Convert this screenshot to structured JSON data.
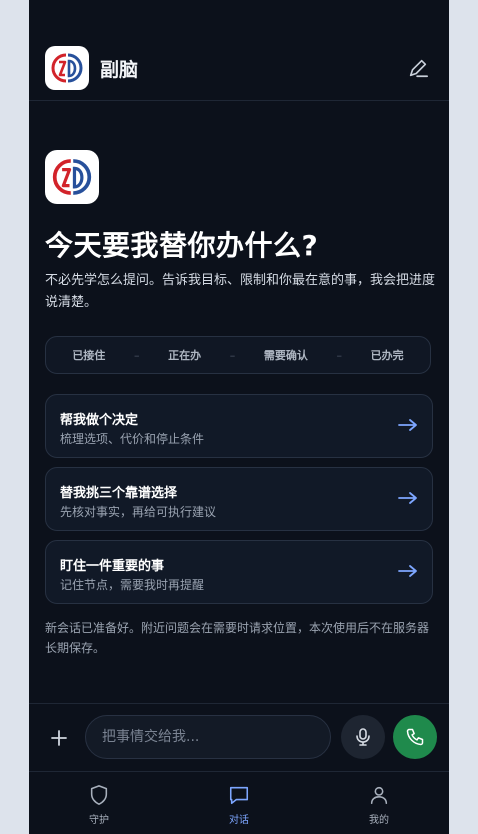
{
  "header": {
    "app_name": "副脑",
    "logo_icon": "brain-logo-icon",
    "edit_icon": "edit-icon"
  },
  "hero": {
    "headline": "今天要我替你办什么?",
    "subline": "不必先学怎么提问。告诉我目标、限制和你最在意的事，我会把进度说清楚。"
  },
  "steps": [
    "已接住",
    "正在办",
    "需要确认",
    "已办完"
  ],
  "step_separator": "–",
  "cards": [
    {
      "title": "帮我做个决定",
      "desc": "梳理选项、代价和停止条件"
    },
    {
      "title": "替我挑三个靠谱选择",
      "desc": "先核对事实，再给可执行建议"
    },
    {
      "title": "盯住一件重要的事",
      "desc": "记住节点，需要我时再提醒"
    }
  ],
  "notice": "新会话已准备好。附近问题会在需要时请求位置，本次使用后不在服务器长期保存。",
  "composer": {
    "placeholder": "把事情交给我...",
    "value": ""
  },
  "tabs": [
    {
      "label": "守护",
      "icon": "shield-icon",
      "active": false
    },
    {
      "label": "对话",
      "icon": "chat-icon",
      "active": true
    },
    {
      "label": "我的",
      "icon": "user-icon",
      "active": false
    }
  ],
  "colors": {
    "background": "#0c111b",
    "accent": "#7da6ff",
    "call_button": "#1f8a4c",
    "logo_red": "#d2232a",
    "logo_blue": "#27509b"
  }
}
